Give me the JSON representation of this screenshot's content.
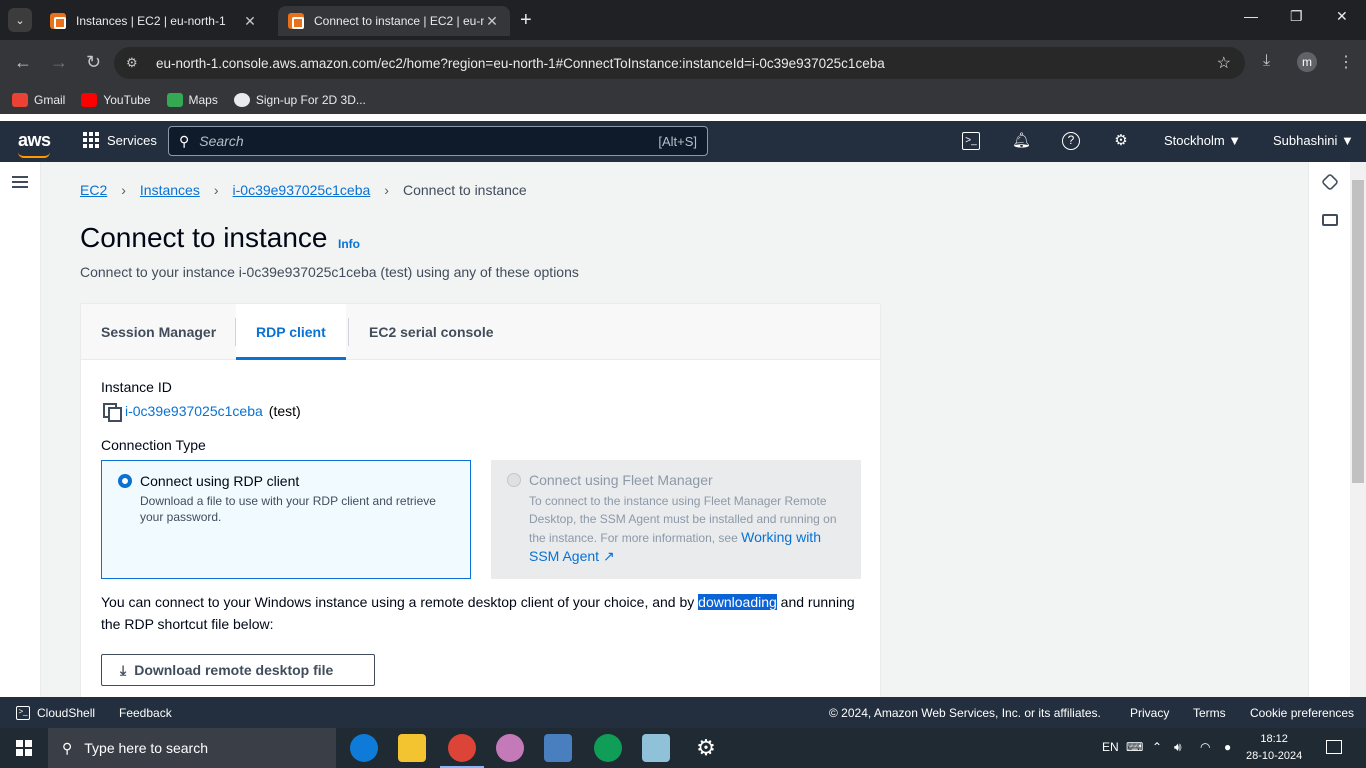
{
  "browser": {
    "tabs": [
      {
        "title": "Instances | EC2 | eu-north-1",
        "active": false
      },
      {
        "title": "Connect to instance | EC2 | eu-n",
        "active": true
      }
    ],
    "url": "eu-north-1.console.aws.amazon.com/ec2/home?region=eu-north-1#ConnectToInstance:instanceId=i-0c39e937025c1ceba",
    "profile_initial": "m",
    "bookmarks": [
      "Gmail",
      "YouTube",
      "Maps",
      "Sign-up For 2D 3D..."
    ]
  },
  "aws_nav": {
    "logo": "aws",
    "services_label": "Services",
    "search_placeholder": "Search",
    "search_shortcut": "[Alt+S]",
    "region": "Stockholm ▼",
    "user": "Subhashini ▼"
  },
  "breadcrumb": {
    "items": [
      "EC2",
      "Instances",
      "i-0c39e937025c1ceba"
    ],
    "current": "Connect to instance"
  },
  "page": {
    "title": "Connect to instance",
    "info": "Info",
    "subtitle": "Connect to your instance i-0c39e937025c1ceba (test) using any of these options"
  },
  "connect_tabs": [
    {
      "label": "Session Manager",
      "selected": false
    },
    {
      "label": "RDP client",
      "selected": true
    },
    {
      "label": "EC2 serial console",
      "selected": false
    }
  ],
  "rdp": {
    "instance_id_label": "Instance ID",
    "instance_id": "i-0c39e937025c1ceba",
    "instance_name": "(test)",
    "connection_type_label": "Connection Type",
    "option_rdp_title": "Connect using RDP client",
    "option_rdp_desc": "Download a file to use with your RDP client and retrieve your password.",
    "option_fleet_title": "Connect using Fleet Manager",
    "option_fleet_desc": "To connect to the instance using Fleet Manager Remote Desktop, the SSM Agent must be installed and running on the instance. For more information, see",
    "option_fleet_link": "Working with SSM Agent",
    "para_before": "You can connect to your Windows instance using a remote desktop client of your choice, and by ",
    "para_highlight": "downloading",
    "para_after": " and running the RDP shortcut file below:",
    "download_button": "Download remote desktop file"
  },
  "footer": {
    "cloudshell": "CloudShell",
    "feedback": "Feedback",
    "copyright": "© 2024, Amazon Web Services, Inc. or its affiliates.",
    "privacy": "Privacy",
    "terms": "Terms",
    "cookies": "Cookie preferences"
  },
  "taskbar": {
    "search_placeholder": "Type here to search",
    "lang": "EN",
    "time": "18:12",
    "date": "28-10-2024"
  },
  "colors": {
    "aws_nav": "#232f3e",
    "link": "#0972d3",
    "aws_orange": "#ff9900"
  }
}
